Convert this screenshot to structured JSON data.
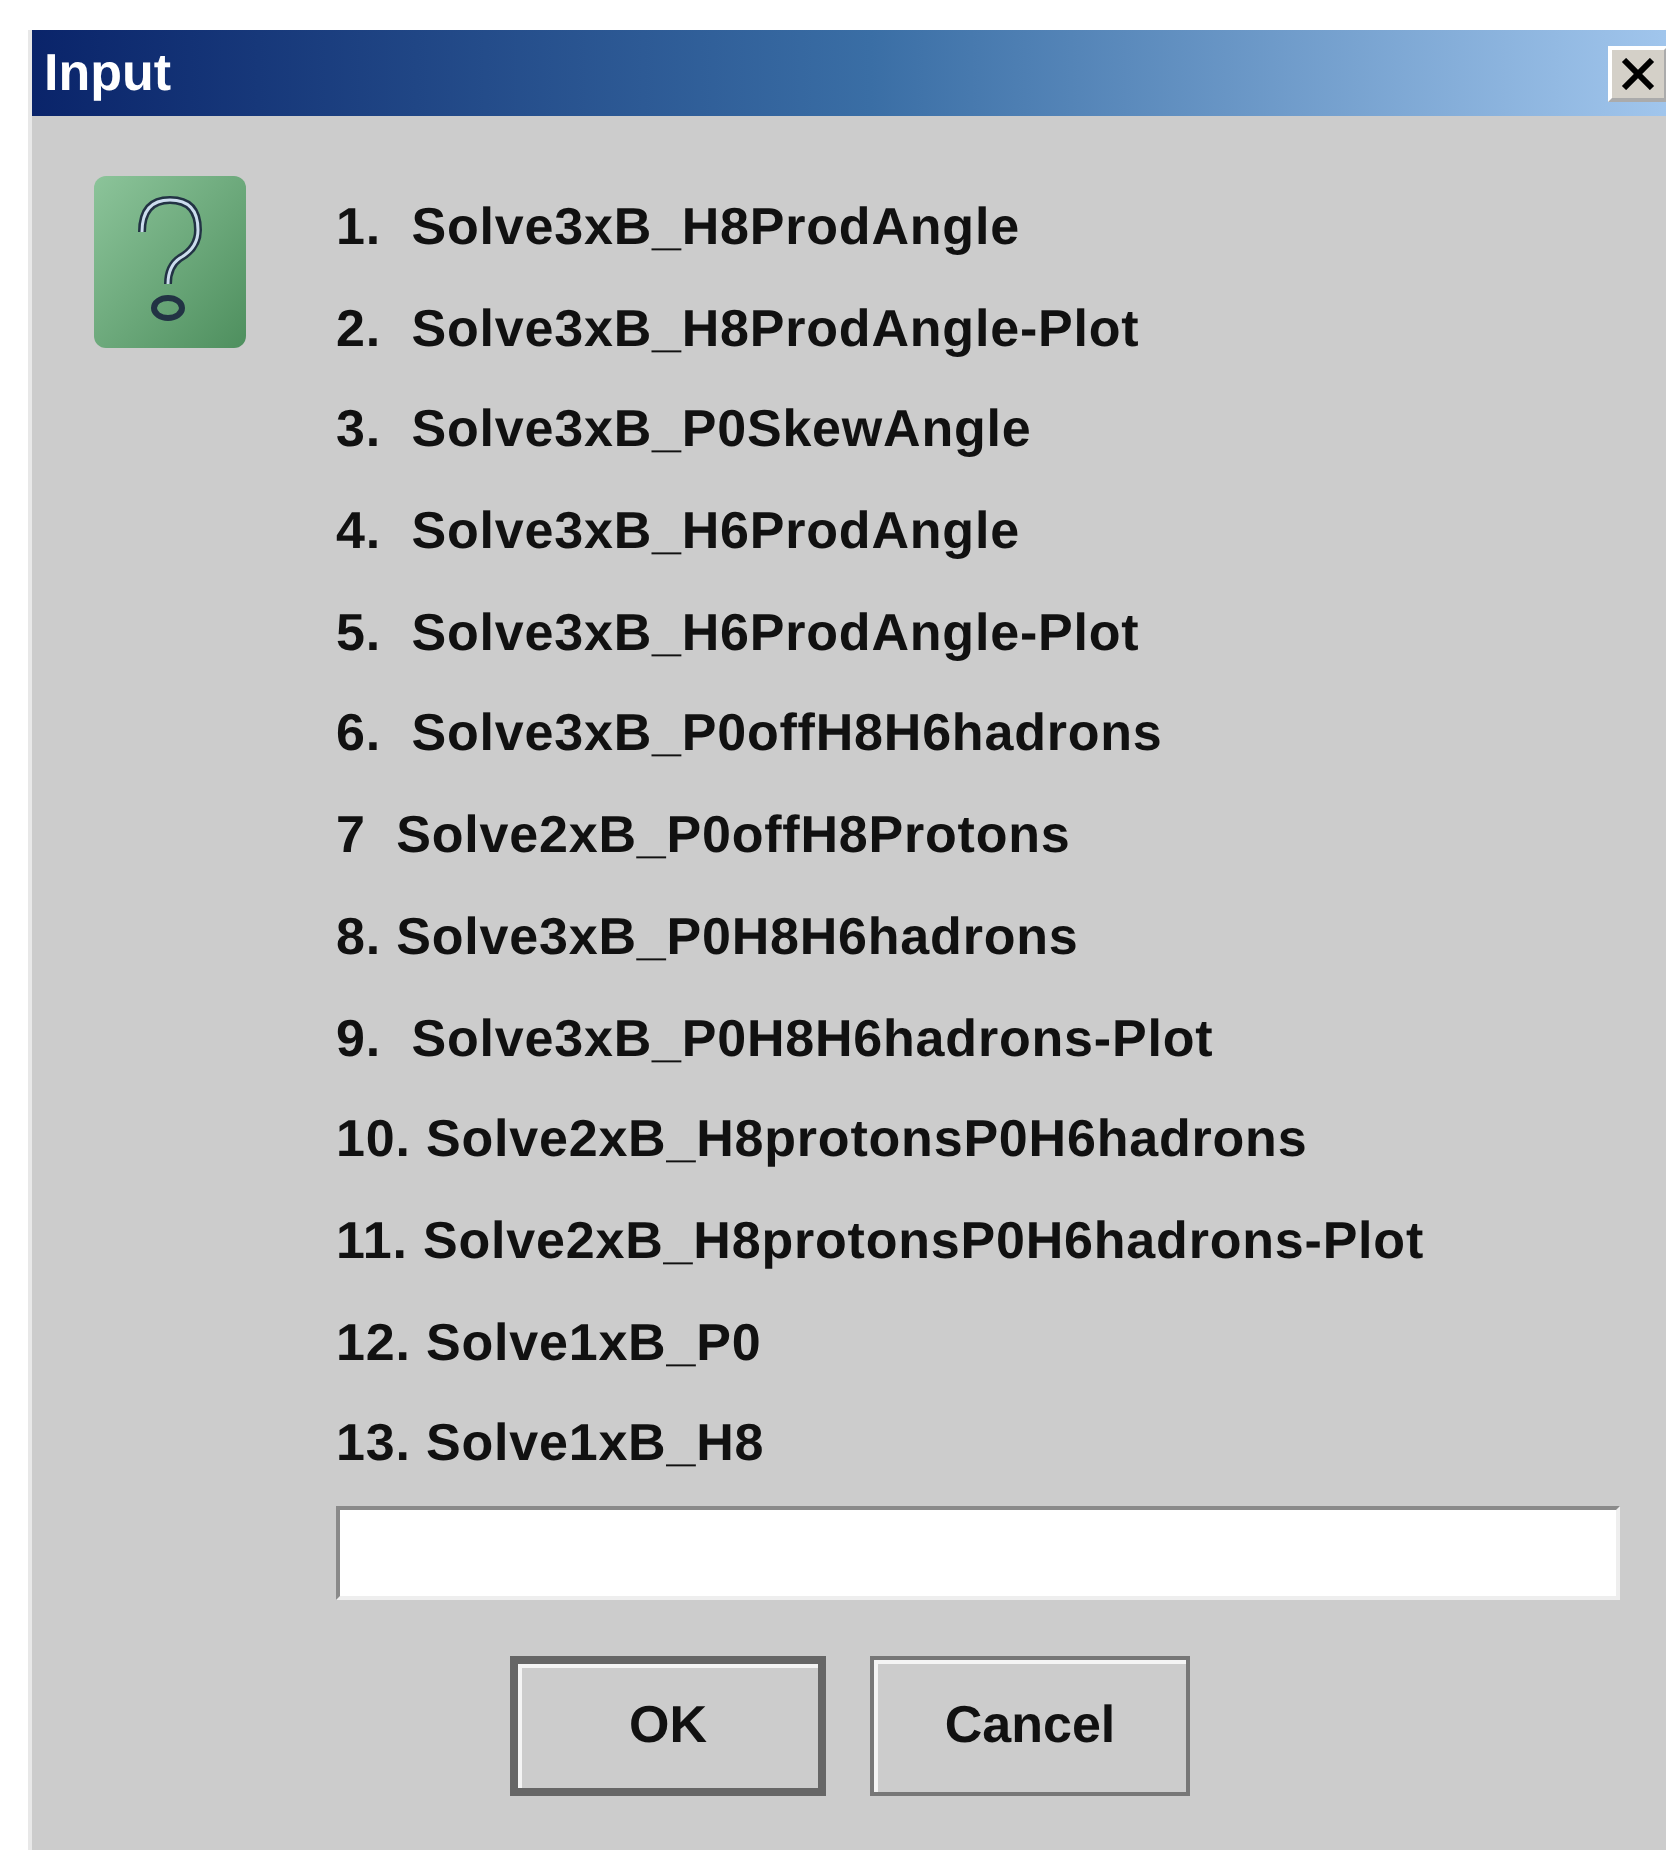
{
  "window": {
    "title": "Input"
  },
  "message_lines": [
    "1.  Solve3xB_H8ProdAngle",
    "2.  Solve3xB_H8ProdAngle-Plot",
    "3.  Solve3xB_P0SkewAngle",
    "4.  Solve3xB_H6ProdAngle",
    "5.  Solve3xB_H6ProdAngle-Plot",
    "6.  Solve3xB_P0offH8H6hadrons",
    "7  Solve2xB_P0offH8Protons",
    "8. Solve3xB_P0H8H6hadrons",
    "9.  Solve3xB_P0H8H6hadrons-Plot",
    "10. Solve2xB_H8protonsP0H6hadrons",
    "11. Solve2xB_H8protonsP0H6hadrons-Plot",
    "12. Solve1xB_P0",
    "13. Solve1xB_H8"
  ],
  "buttons": [
    {
      "label": "OK",
      "default": true
    },
    {
      "label": "Cancel",
      "default": false
    }
  ]
}
